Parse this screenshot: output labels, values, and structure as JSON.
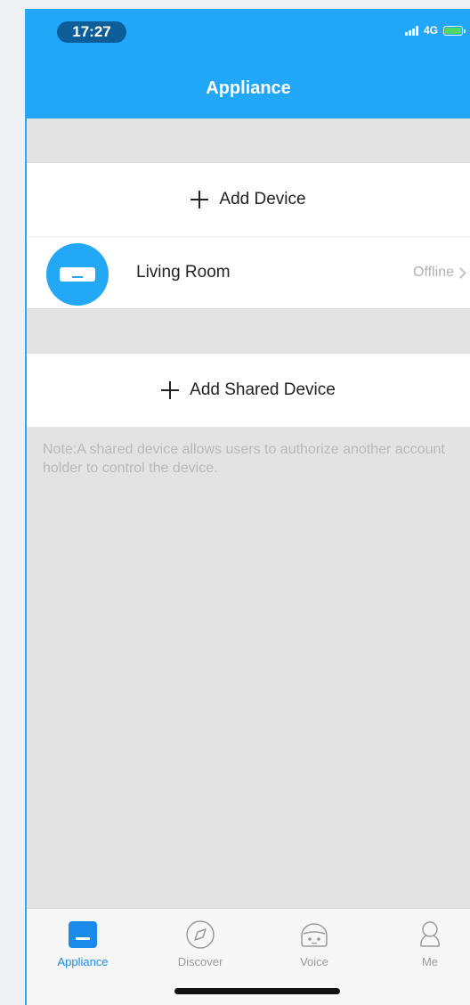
{
  "status_bar": {
    "time": "17:27",
    "network": "4G"
  },
  "header": {
    "title": "Appliance",
    "color": "#21a6f8"
  },
  "add_device": {
    "label": "Add Device"
  },
  "devices": [
    {
      "name": "Living Room",
      "status": "Offline",
      "icon": "air-conditioner-icon"
    }
  ],
  "add_shared_device": {
    "label": "Add Shared Device"
  },
  "note": "Note:A shared device allows users to authorize another account holder to control the device.",
  "tab_bar": {
    "tabs": [
      {
        "label": "Appliance",
        "icon": "appliance-icon",
        "active": true
      },
      {
        "label": "Discover",
        "icon": "compass-icon",
        "active": false
      },
      {
        "label": "Voice",
        "icon": "robot-icon",
        "active": false
      },
      {
        "label": "Me",
        "icon": "person-icon",
        "active": false
      }
    ],
    "active_color": "#1a8bea"
  }
}
